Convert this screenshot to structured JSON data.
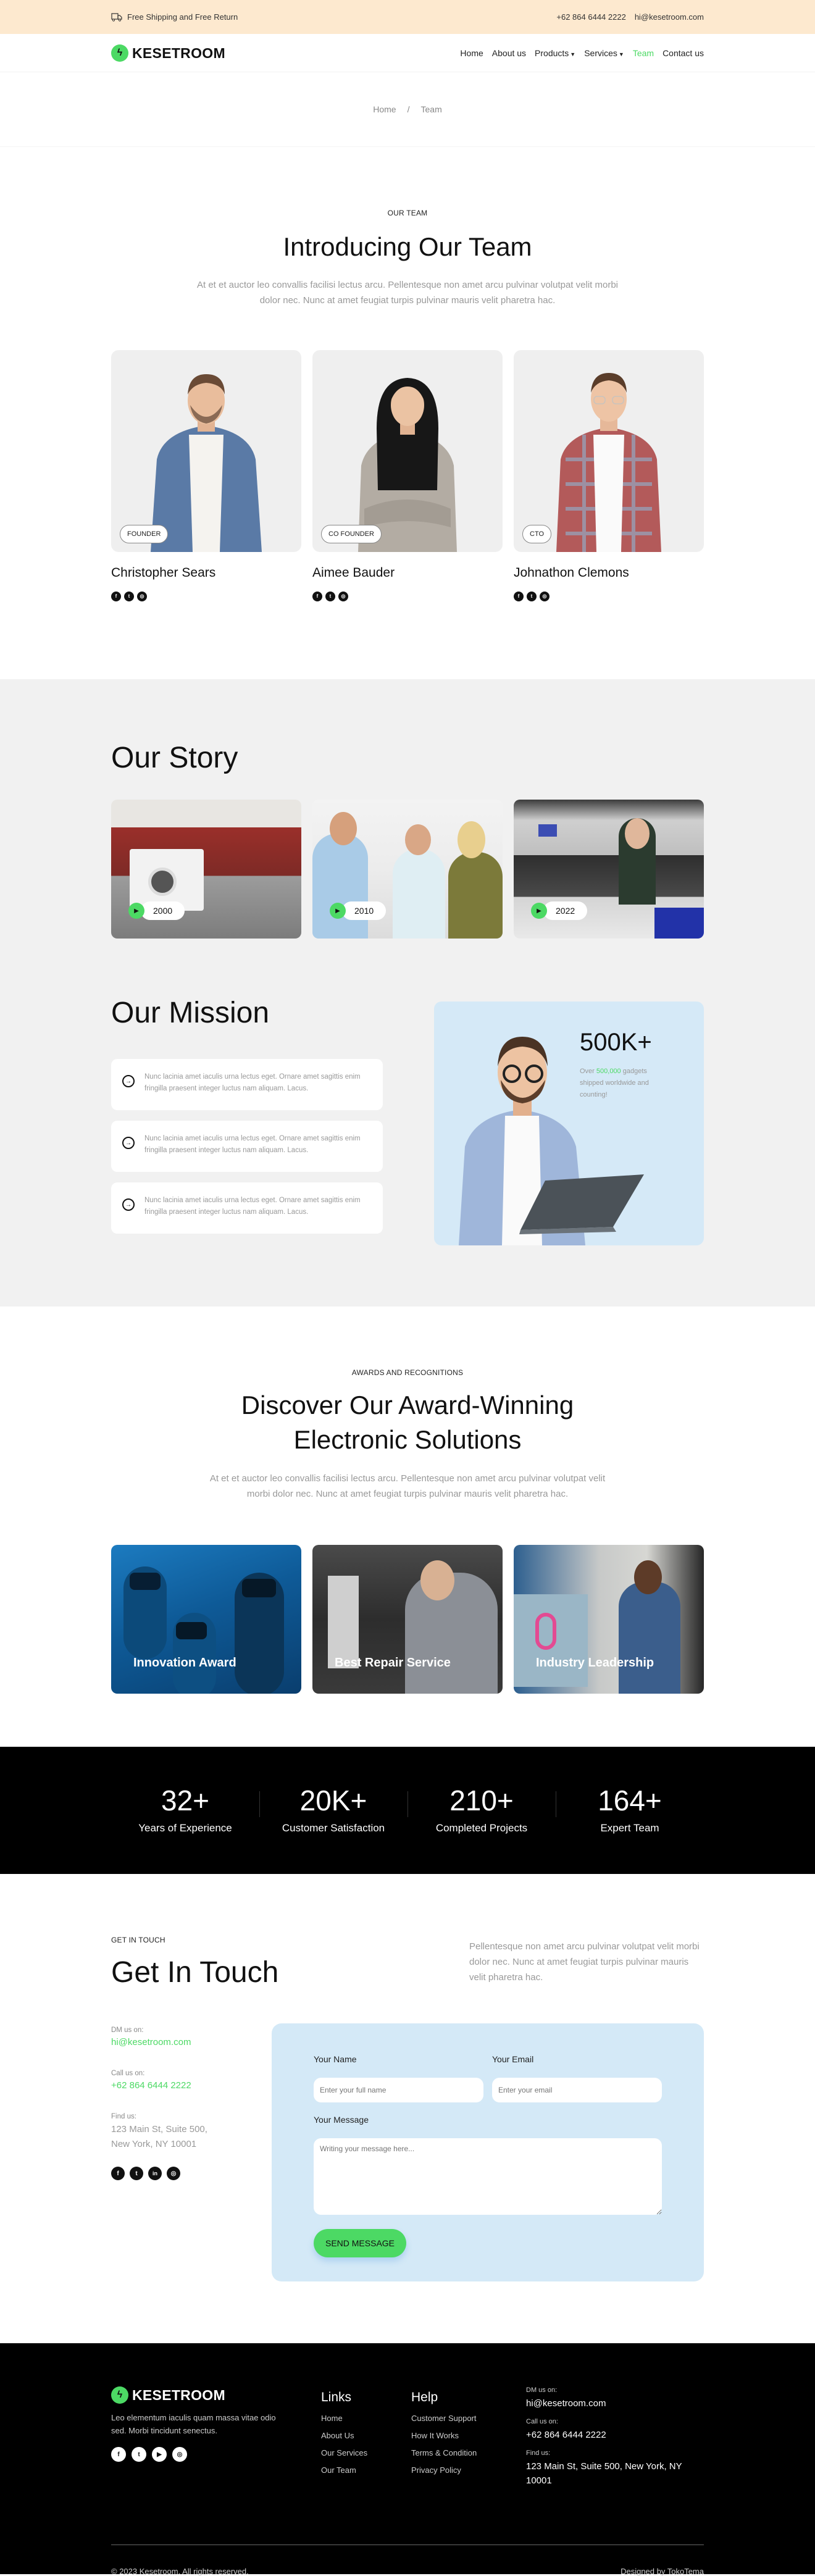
{
  "topbar": {
    "shipping_text": "Free Shipping and Free Return",
    "phone": "+62 864 6444 2222",
    "email": "hi@kesetroom.com"
  },
  "header": {
    "brand": "KESETROOM",
    "nav": [
      {
        "label": "Home"
      },
      {
        "label": "About us"
      },
      {
        "label": "Products",
        "dropdown": true
      },
      {
        "label": "Services",
        "dropdown": true
      },
      {
        "label": "Team",
        "active": true
      },
      {
        "label": "Contact us"
      }
    ]
  },
  "breadcrumb": {
    "home": "Home",
    "separator": "/",
    "current": "Team"
  },
  "team": {
    "eyebrow": "OUR TEAM",
    "title": "Introducing Our Team",
    "description": "At et et auctor leo convallis facilisi lectus arcu. Pellentesque non amet arcu pulvinar volutpat velit morbi dolor nec. Nunc at amet feugiat turpis pulvinar mauris velit pharetra hac.",
    "members": [
      {
        "name": "Christopher Sears",
        "role": "FOUNDER"
      },
      {
        "name": "Aimee Bauder",
        "role": "CO FOUNDER"
      },
      {
        "name": "Johnathon Clemons",
        "role": "CTO"
      }
    ]
  },
  "story": {
    "title": "Our Story",
    "items": [
      {
        "year": "2000"
      },
      {
        "year": "2010"
      },
      {
        "year": "2022"
      }
    ]
  },
  "mission": {
    "title": "Our Mission",
    "items": [
      "Nunc lacinia amet iaculis urna lectus eget. Ornare amet sagittis enim fringilla praesent integer luctus nam aliquam. Lacus.",
      "Nunc lacinia amet iaculis urna lectus eget. Ornare amet sagittis enim fringilla praesent integer luctus nam aliquam. Lacus.",
      "Nunc lacinia amet iaculis urna lectus eget. Ornare amet sagittis enim fringilla praesent integer luctus nam aliquam. Lacus."
    ],
    "stat_value": "500K+",
    "stat_prefix": "Over ",
    "stat_highlight": "500,000",
    "stat_suffix": " gadgets shipped worldwide and counting!"
  },
  "awards": {
    "eyebrow": "AWARDS AND RECOGNITIONS",
    "title_line1": "Discover Our Award-Winning",
    "title_line2": "Electronic Solutions",
    "description": "At et et auctor leo convallis facilisi lectus arcu. Pellentesque non amet arcu pulvinar volutpat velit morbi dolor nec. Nunc at amet feugiat turpis pulvinar mauris velit pharetra hac.",
    "items": [
      {
        "title": "Innovation Award"
      },
      {
        "title": "Best Repair Service"
      },
      {
        "title": "Industry Leadership"
      }
    ]
  },
  "stats": [
    {
      "value": "32+",
      "label": "Years of Experience"
    },
    {
      "value": "20K+",
      "label": "Customer Satisfaction"
    },
    {
      "value": "210+",
      "label": "Completed Projects"
    },
    {
      "value": "164+",
      "label": "Expert Team"
    }
  ],
  "contact": {
    "eyebrow": "GET IN TOUCH",
    "title": "Get In Touch",
    "description": "Pellentesque non amet arcu pulvinar volutpat velit morbi dolor nec. Nunc at amet feugiat turpis pulvinar mauris velit pharetra hac.",
    "dm_label": "DM us on:",
    "email": "hi@kesetroom.com",
    "call_label": "Call us on:",
    "phone": "+62 864 6444 2222",
    "find_label": "Find us:",
    "address_line1": "123 Main St, Suite 500,",
    "address_line2": "New York, NY 10001",
    "form": {
      "name_label": "Your Name",
      "name_placeholder": "Enter your full name",
      "email_label": "Your Email",
      "email_placeholder": "Enter your email",
      "message_label": "Your Message",
      "message_placeholder": "Writing your message here...",
      "submit": "SEND MESSAGE"
    }
  },
  "footer": {
    "brand": "KESETROOM",
    "description": "Leo elementum iaculis quam massa vitae odio sed. Morbi tincidunt senectus.",
    "links_title": "Links",
    "links": [
      "Home",
      "About Us",
      "Our Services",
      "Our Team"
    ],
    "help_title": "Help",
    "help": [
      "Customer Support",
      "How It Works",
      "Terms & Condition",
      "Privacy Policy"
    ],
    "dm_label": "DM us on:",
    "email": "hi@kesetroom.com",
    "call_label": "Call us on:",
    "phone": "+62 864 6444 2222",
    "find_label": "Find us:",
    "address": "123 Main St, Suite 500, New York, NY 10001",
    "copyright": "© 2023 Kesetroom. All rights reserved.",
    "credit": "Designed by TokoTema"
  },
  "colors": {
    "accent": "#4cd964",
    "topbar_bg": "#fde9cf",
    "light_blue": "#d4e9f7",
    "section_grey": "#f1f1f1"
  }
}
